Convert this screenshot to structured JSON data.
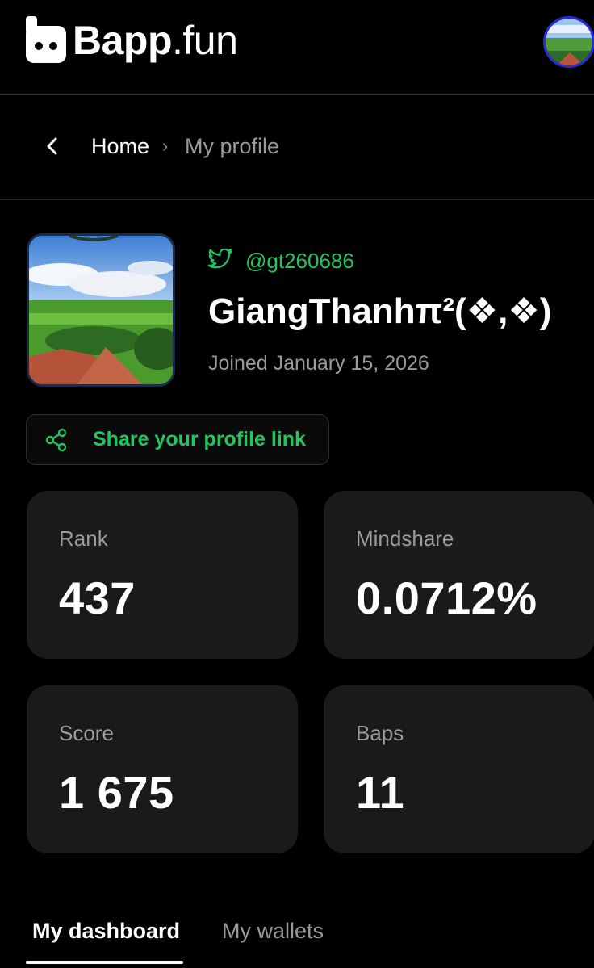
{
  "header": {
    "logo_bold": "Bapp",
    "logo_thin": ".fun"
  },
  "breadcrumb": {
    "home": "Home",
    "separator": "›",
    "current": "My profile"
  },
  "profile": {
    "twitter_handle": "@gt260686",
    "display_name": "GiangThanhπ²(❖,❖)",
    "joined": "Joined January 15, 2026",
    "share_label": "Share your profile link"
  },
  "stats": [
    {
      "label": "Rank",
      "value": "437"
    },
    {
      "label": "Mindshare",
      "value": "0.0712%"
    },
    {
      "label": "Score",
      "value": "1 675"
    },
    {
      "label": "Baps",
      "value": "11"
    }
  ],
  "tabs": [
    {
      "label": "My dashboard",
      "active": true
    },
    {
      "label": "My wallets",
      "active": false
    }
  ],
  "colors": {
    "accent_green": "#22c55e",
    "card_bg": "#1a1a1a",
    "background": "#000000"
  },
  "icons": {
    "logo": "bapp-logo-icon",
    "back": "chevron-left-icon",
    "twitter": "twitter-icon",
    "share": "share-icon"
  }
}
